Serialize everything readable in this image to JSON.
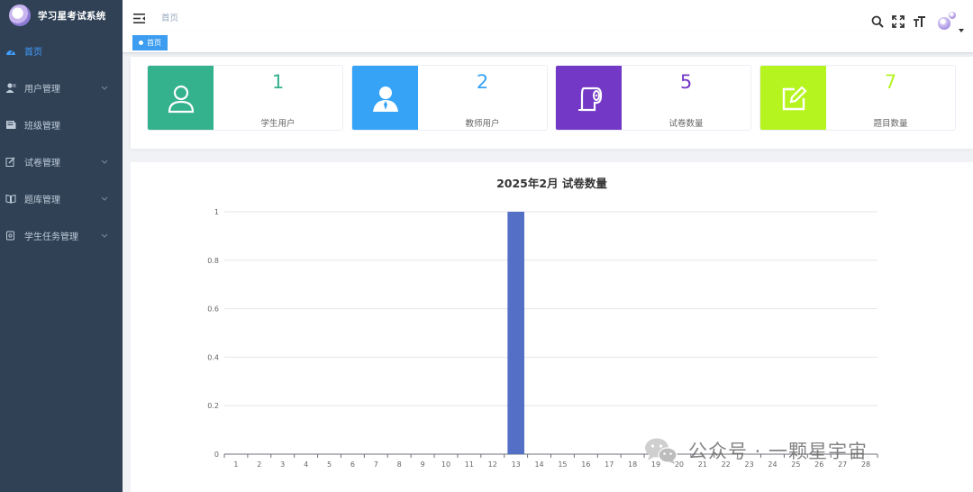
{
  "sidebar": {
    "app_title": "学习星考试系统",
    "items": [
      {
        "label": "首页",
        "icon": "dashboard-icon",
        "active": true
      },
      {
        "label": "用户管理",
        "icon": "user-icon"
      },
      {
        "label": "班级管理",
        "icon": "class-icon"
      },
      {
        "label": "试卷管理",
        "icon": "edit-icon"
      },
      {
        "label": "题库管理",
        "icon": "book-icon"
      },
      {
        "label": "学生任务管理",
        "icon": "task-icon"
      }
    ]
  },
  "navbar": {
    "breadcrumb": "首页",
    "tools": [
      "search-icon",
      "fullscreen-icon",
      "font-size-icon"
    ]
  },
  "tags": {
    "active_tag": "首页"
  },
  "stats": [
    {
      "value": "1",
      "label": "学生用户",
      "color": "#34b18d",
      "icon": "student-user-icon"
    },
    {
      "value": "2",
      "label": "教师用户",
      "color": "#36a3f7",
      "icon": "teacher-user-icon"
    },
    {
      "value": "5",
      "label": "试卷数量",
      "color": "#7338c6",
      "icon": "paper-roll-icon"
    },
    {
      "value": "7",
      "label": "题目数量",
      "color": "#b6f420",
      "icon": "question-edit-icon"
    }
  ],
  "watermark": {
    "text": "公众号 · 一颗星宇宙",
    "icon": "wechat-icon"
  },
  "chart_data": {
    "type": "bar",
    "title": "2025年2月 试卷数量",
    "categories": [
      "1",
      "2",
      "3",
      "4",
      "5",
      "6",
      "7",
      "8",
      "9",
      "10",
      "11",
      "12",
      "13",
      "14",
      "15",
      "16",
      "17",
      "18",
      "19",
      "20",
      "21",
      "22",
      "23",
      "24",
      "25",
      "26",
      "27",
      "28"
    ],
    "values": [
      0,
      0,
      0,
      0,
      0,
      0,
      0,
      0,
      0,
      0,
      0,
      0,
      1,
      0,
      0,
      0,
      0,
      0,
      0,
      0,
      0,
      0,
      0,
      0,
      0,
      0,
      0,
      0
    ],
    "yticks": [
      "0",
      "0.2",
      "0.4",
      "0.6",
      "0.8",
      "1"
    ],
    "ylim": [
      0,
      1
    ],
    "grid": true,
    "bar_color": "#5470c6"
  }
}
